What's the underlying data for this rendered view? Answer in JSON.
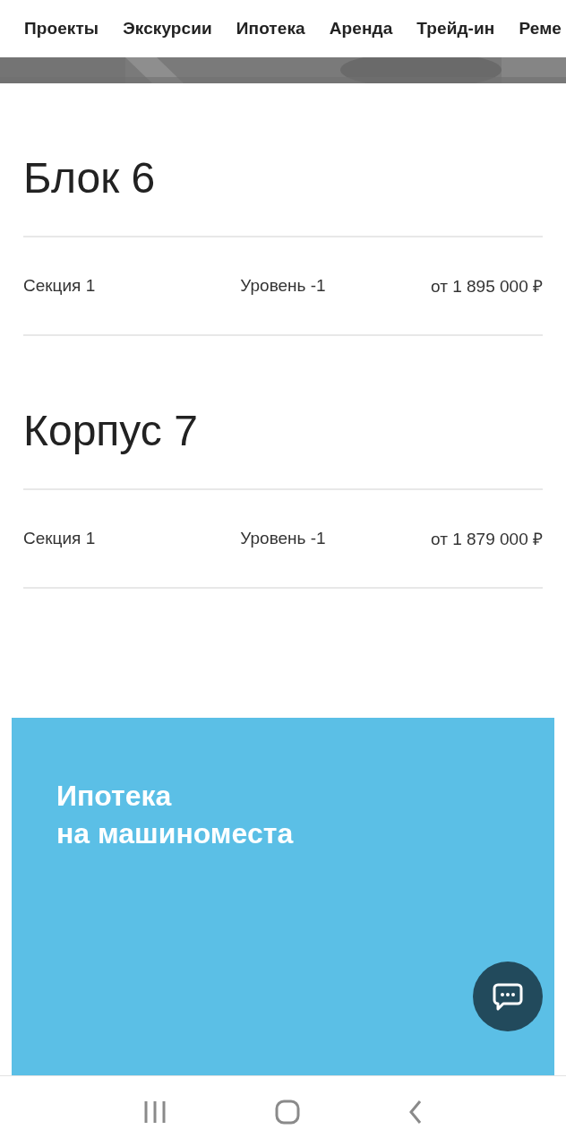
{
  "top_nav": {
    "items": [
      {
        "label": "Проекты"
      },
      {
        "label": "Экскурсии"
      },
      {
        "label": "Ипотека"
      },
      {
        "label": "Аренда"
      },
      {
        "label": "Трейд-ин"
      },
      {
        "label": "Реме"
      }
    ]
  },
  "buildings": [
    {
      "title": "Блок 6",
      "rows": [
        {
          "section": "Секция 1",
          "level_label": "Уровень -1",
          "price": "от 1 895 000 ₽"
        }
      ]
    },
    {
      "title": "Корпус 7",
      "rows": [
        {
          "section": "Секция 1",
          "level_label": "Уровень -1",
          "price": "от 1 879 000 ₽"
        }
      ]
    }
  ],
  "promo": {
    "title_lines": [
      "Ипотека",
      "на машиноместа"
    ]
  }
}
